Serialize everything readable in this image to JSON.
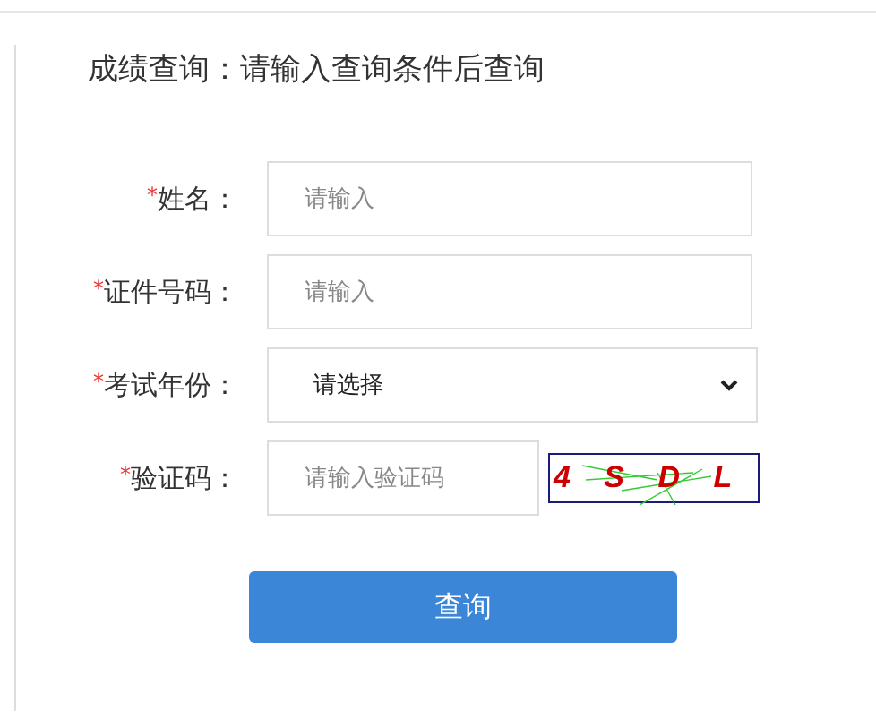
{
  "title": "成绩查询：请输入查询条件后查询",
  "fields": [
    {
      "kind": "input",
      "required_mark": "*",
      "label": "姓名：",
      "placeholder": "请输入"
    },
    {
      "kind": "input",
      "required_mark": "*",
      "label": "证件号码：",
      "placeholder": "请输入"
    },
    {
      "kind": "select",
      "required_mark": "*",
      "label": "考试年份：",
      "value": "请选择"
    },
    {
      "kind": "captcha",
      "required_mark": "*",
      "label": "验证码：",
      "placeholder": "请输入验证码",
      "captcha_text": "4 S D L"
    }
  ],
  "submit_button": "查询"
}
